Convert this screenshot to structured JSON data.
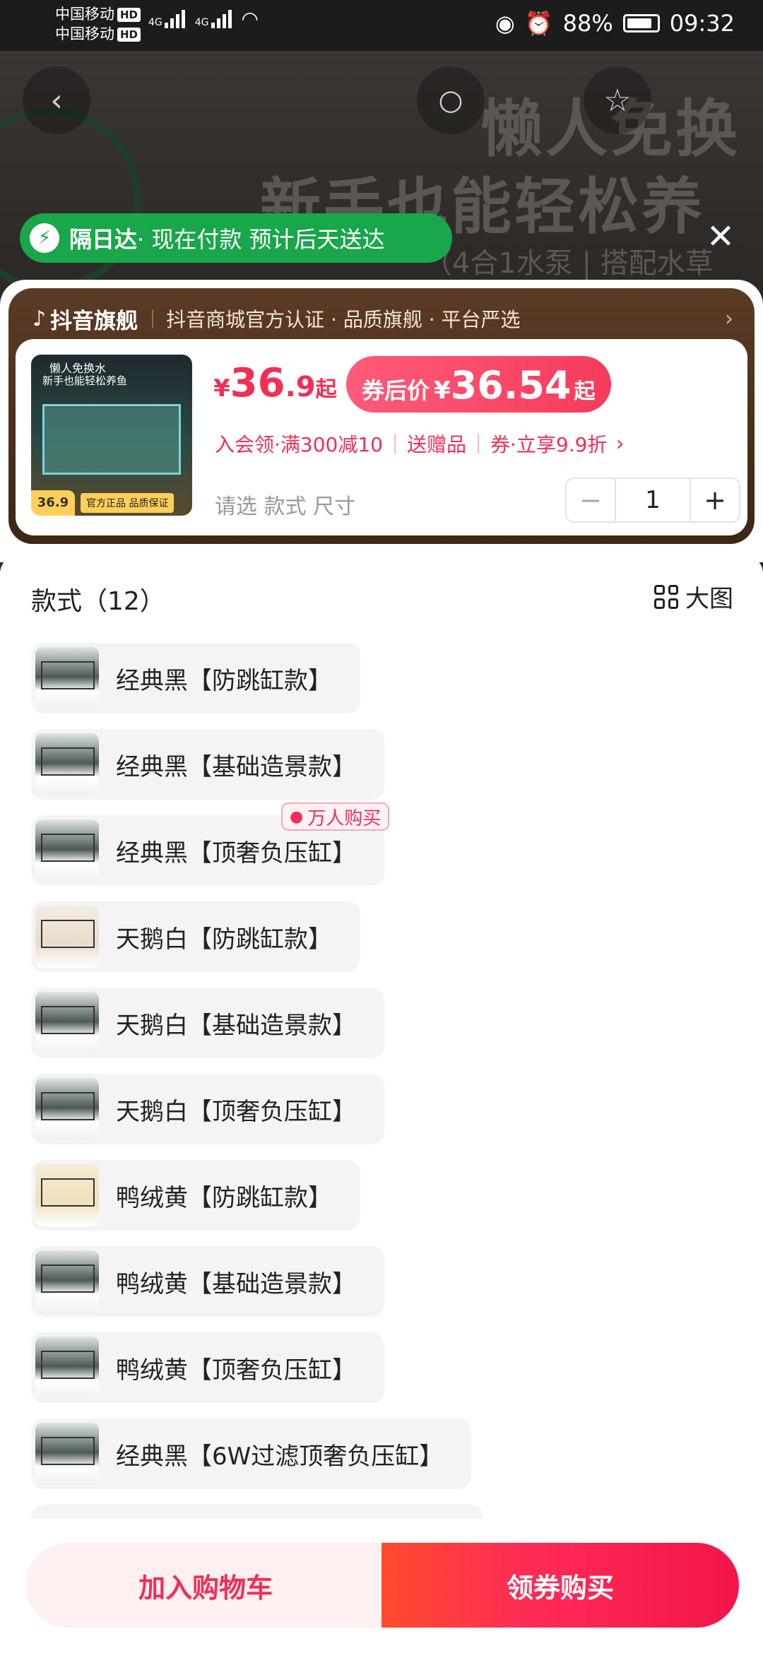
{
  "status_bar": {
    "carrier1": "中国移动",
    "carrier2": "中国移动",
    "hd": "HD",
    "net1": "4G",
    "net2": "4G",
    "battery": "88%",
    "time": "09:32"
  },
  "hero": {
    "line1": "懒人免换",
    "line2": "新手也能轻松养",
    "line3": "（4合1水泵 | 搭配水草"
  },
  "delivery": {
    "label": "隔日达",
    "text": " · 现在付款 预计后天送达"
  },
  "store": {
    "brand": "抖音旗舰",
    "tags": "抖音商城官方认证 · 品质旗舰 · 平台严选"
  },
  "product": {
    "thumb_text": "懒人免换水",
    "thumb_text2": "新手也能轻松养鱼",
    "thumb_price": "36.9",
    "thumb_tag": "官方正品 品质保证",
    "price_yen": "¥",
    "price_int": "36",
    "price_dec": ".9",
    "price_suffix": "起",
    "coupon_label": "券后价",
    "coupon_yen": "¥",
    "coupon_value": "36.54",
    "coupon_suffix": "起",
    "promo1": "入会领·满300减10",
    "promo2": "送赠品",
    "promo3": "券·立享9.9折",
    "select_hint": "请选 款式 尺寸",
    "quantity": "1"
  },
  "variants_section": {
    "title": "款式（12）",
    "big_view": "大图"
  },
  "variants": [
    "经典黑【防跳缸款】",
    "经典黑【基础造景款】",
    "经典黑【顶奢负压缸】",
    "天鹅白【防跳缸款】",
    "天鹅白【基础造景款】",
    "天鹅白【顶奢负压缸】",
    "鸭绒黄【防跳缸款】",
    "鸭绒黄【基础造景款】",
    "鸭绒黄【顶奢负压缸】",
    "经典黑【6W过滤顶奢负压缸】"
  ],
  "badge": "万人购买",
  "bottom": {
    "add_cart": "加入购物车",
    "buy": "领券购买"
  },
  "colors": {
    "accent": "#f22e56",
    "delivery_green": "#1aa64a",
    "card_brown": "#4e3220"
  }
}
